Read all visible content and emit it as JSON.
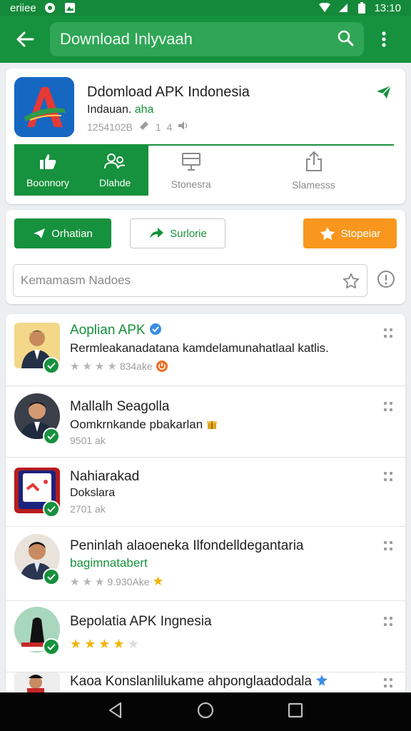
{
  "status_bar": {
    "carrier": "eriiee",
    "time": "13:10"
  },
  "app_bar": {
    "search_text": "Download Inlyvaah"
  },
  "app_card": {
    "title": "Ddomload APK Indonesia",
    "subtitle_main": "Indauan. ",
    "subtitle_highlight": "aha",
    "meta_id": "1254102B",
    "meta_count": "1",
    "meta_rating": "4",
    "tabs": [
      {
        "label": "Boonnory",
        "icon": "thumbs-up-icon"
      },
      {
        "label": "Dlahde",
        "icon": "people-icon"
      },
      {
        "label": "Stonesra",
        "icon": "monitor-icon"
      },
      {
        "label": "Slamesss",
        "icon": "upload-icon"
      }
    ]
  },
  "actions": {
    "primary_label": "Orhatian",
    "secondary_label": "Surlorie",
    "featured_label": "Stopeiar",
    "input_placeholder": "Kemamasm Nadoes"
  },
  "list": [
    {
      "title": "Aoplian APK",
      "line2": "Rermleakanadatana kamdelamunahatlaal katlis.",
      "meta": "834ake",
      "rating": 4
    },
    {
      "title": "Mallalh Seagolla",
      "line2": "Oomkrnkande pbakarlan",
      "meta": "9501 ak"
    },
    {
      "title": "Nahiarakad",
      "line2": "Dokslara",
      "meta": "2701 ak"
    },
    {
      "title": "Peninlah alaoeneka Ilfondelldegantaria",
      "line2": "bagimnatabert",
      "meta": "9.930Ake",
      "rating": 3
    },
    {
      "title": "Bepolatia APK Ingnesia",
      "rating": 4
    },
    {
      "title": "Kaoa Konslanlilukame ahponglaadodala"
    }
  ],
  "colors": {
    "brand_green": "#16913d",
    "accent_orange": "#f8961e",
    "star_gold": "#f4b400"
  }
}
